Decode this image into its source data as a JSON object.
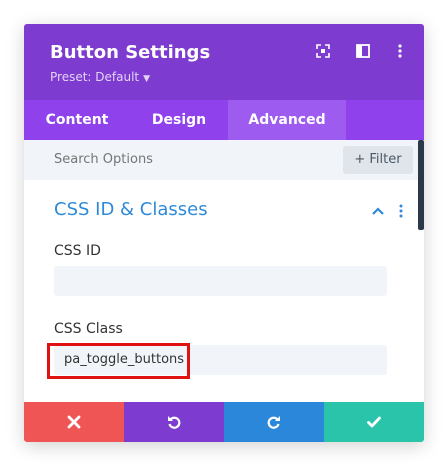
{
  "header": {
    "title": "Button Settings",
    "preset": "Preset: Default"
  },
  "tabs": [
    {
      "label": "Content"
    },
    {
      "label": "Design"
    },
    {
      "label": "Advanced",
      "active": true
    }
  ],
  "search": {
    "placeholder": "Search Options",
    "filter_label": "+ Filter"
  },
  "section": {
    "title": "CSS ID & Classes",
    "css_id_label": "CSS ID",
    "css_id_value": "",
    "css_class_label": "CSS Class",
    "css_class_value": "pa_toggle_buttons"
  },
  "colors": {
    "header_bg": "#7e3bd0",
    "tabs_bg": "#8f42ec",
    "cancel": "#ef5555",
    "undo": "#7e3bd0",
    "redo": "#2b87da",
    "save": "#29c4a9",
    "section_title": "#2e8ad8",
    "highlight": "#e01111"
  },
  "footer": {
    "buttons": [
      "close-icon",
      "undo-icon",
      "redo-icon",
      "check-icon"
    ]
  }
}
